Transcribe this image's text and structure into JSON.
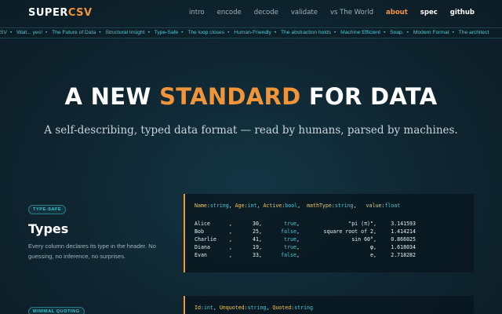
{
  "logo": {
    "part1": "SUPER",
    "part2": "CSV"
  },
  "nav": [
    {
      "label": "intro",
      "state": "normal"
    },
    {
      "label": "encode",
      "state": "normal"
    },
    {
      "label": "decode",
      "state": "normal"
    },
    {
      "label": "validate",
      "state": "normal"
    },
    {
      "label": "vs The World",
      "state": "normal"
    },
    {
      "label": "about",
      "state": "active"
    },
    {
      "label": "spec",
      "state": "strong"
    },
    {
      "label": "github",
      "state": "strong"
    }
  ],
  "ticker": [
    "SV",
    "Wait... yes!",
    "The Future of Data",
    "Structural Insight",
    "Type-Safe",
    "The loop closes",
    "Human-Friendly",
    "The abstraction holds",
    "Machine Efficient",
    "Snap.",
    "Modern Format",
    "The architect"
  ],
  "hero": {
    "title_pre": "A NEW ",
    "title_highlight": "STANDARD",
    "title_post": " FOR DATA",
    "subtitle": "A self-describing, typed data format — read by humans, parsed by machines."
  },
  "feature1": {
    "badge": "TYPE-SAFE",
    "title": "Types",
    "description": "Every column declares its type in the header. No guessing, no inference, no surprises.",
    "header": [
      {
        "key": "Name",
        "type": "string"
      },
      {
        "key": "Age",
        "type": "int"
      },
      {
        "key": "Active",
        "type": "bool"
      },
      {
        "key": "mathType",
        "type": "string"
      },
      {
        "key": "value",
        "type": "float"
      }
    ],
    "rows": [
      {
        "name": "Alice",
        "age": "30",
        "active": "true",
        "math": "\"pi (π)\"",
        "value": "3.141593"
      },
      {
        "name": "Bob",
        "age": "25",
        "active": "false",
        "math": "square root of 2",
        "value": "1.414214"
      },
      {
        "name": "Charlie",
        "age": "41",
        "active": "true",
        "math": "sin 60°",
        "value": "0.866025"
      },
      {
        "name": "Diana",
        "age": "19",
        "active": "true",
        "math": "φ",
        "value": "1.618034"
      },
      {
        "name": "Evan",
        "age": "33",
        "active": "false",
        "math": "e",
        "value": "2.718282"
      }
    ]
  },
  "feature2": {
    "badge": "MINIMAL QUOTING",
    "header": [
      {
        "key": "Id",
        "type": "int"
      },
      {
        "key": "Unquoted",
        "type": "string"
      },
      {
        "key": "Quoted",
        "type": "string"
      }
    ]
  },
  "colors": {
    "accent": "#f0953a",
    "cyan": "#4fc5d4",
    "background": "#0f2530"
  }
}
